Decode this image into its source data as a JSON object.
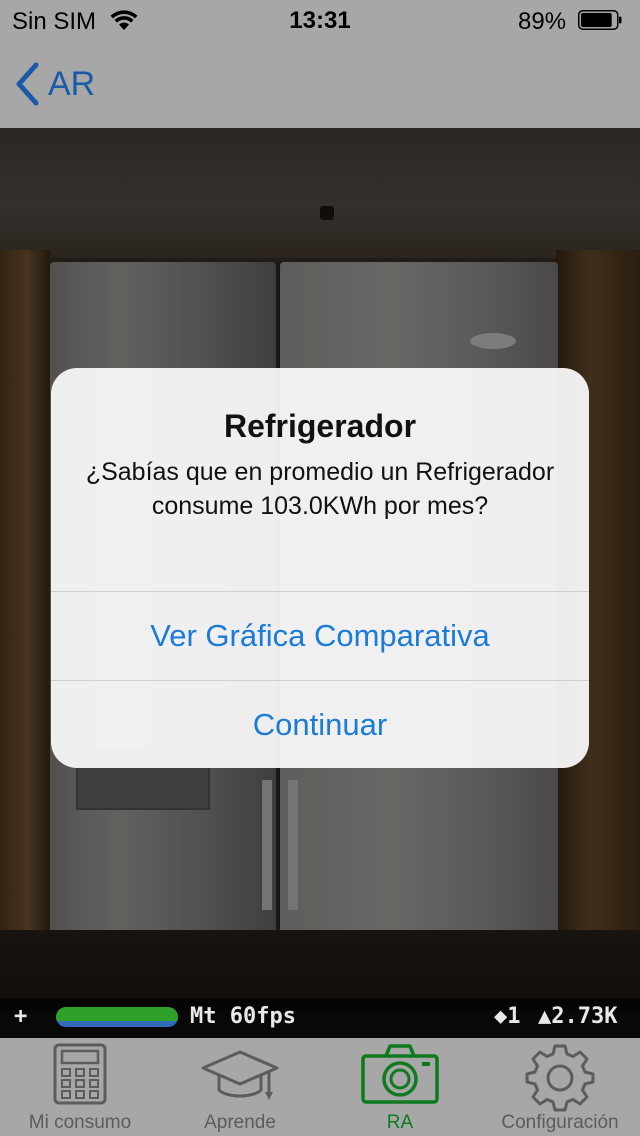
{
  "status_bar": {
    "carrier": "Sin SIM",
    "time": "13:31",
    "battery_percent": "89%",
    "battery_level": 0.89
  },
  "nav": {
    "back_label": "AR"
  },
  "alert": {
    "title": "Refrigerador",
    "message": "¿Sabías que en promedio un Refrigerador consume 103.0KWh por mes?",
    "actions": [
      {
        "label": "Ver Gráfica Comparativa"
      },
      {
        "label": "Continuar"
      }
    ]
  },
  "stats": {
    "plus": "+",
    "fps_text": "Mt 60fps",
    "nodes": "◆1",
    "triangles": "▲2.73K"
  },
  "tabs": [
    {
      "label": "Mi consumo",
      "icon": "calculator-icon"
    },
    {
      "label": "Aprende",
      "icon": "graduation-cap-icon"
    },
    {
      "label": "RA",
      "icon": "camera-icon",
      "active": true
    },
    {
      "label": "Configuración",
      "icon": "gear-icon"
    }
  ],
  "colors": {
    "accent_blue": "#1a7bd8",
    "nav_blue": "#1a5aa6",
    "active_tab_green": "#0e7a1f",
    "bar_gray": "#a7a7a7"
  }
}
